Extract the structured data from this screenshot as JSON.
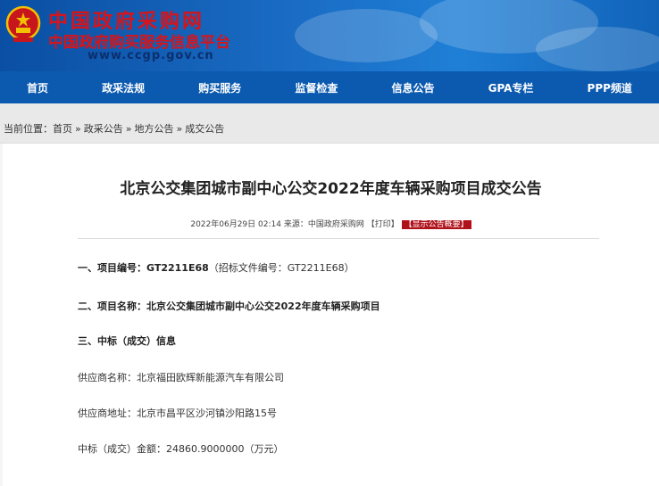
{
  "header": {
    "site_name": "中国政府采购网",
    "site_subtitle": "中国政府购买服务信息平台",
    "site_url": "www.ccgp.gov.cn",
    "accent_color": "#d7141a",
    "nav_color": "#0b5aaf"
  },
  "nav": {
    "items": [
      "首页",
      "政采法规",
      "购买服务",
      "监督检查",
      "信息公告",
      "GPA专栏",
      "PPP频道"
    ]
  },
  "breadcrumb": {
    "label": "当前位置：",
    "items": [
      "首页",
      "政采公告",
      "地方公告",
      "成交公告"
    ],
    "separator": "»"
  },
  "article": {
    "title": "北京公交集团城市副中心公交2022年度车辆采购项目成交公告",
    "datetime": "2022年06月29日 02:14",
    "source_label": "来源：",
    "source": "中国政府采购网",
    "print_label": "【打印】",
    "summary_label": "【显示公告概要】",
    "sec1_label": "一、项目编号：",
    "project_number": "GT2211E68",
    "bid_doc_number": "（招标文件编号：GT2211E68）",
    "sec2_label": "二、项目名称：",
    "project_name": "北京公交集团城市副中心公交2022年度车辆采购项目",
    "sec3_label": "三、中标（成交）信息",
    "supplier_name_label": "供应商名称：",
    "supplier_name": "北京福田欧辉新能源汽车有限公司",
    "supplier_address_label": "供应商地址：",
    "supplier_address": "北京市昌平区沙河镇沙阳路15号",
    "amount_label": "中标（成交）金额：",
    "amount": "24860.9000000（万元）"
  }
}
